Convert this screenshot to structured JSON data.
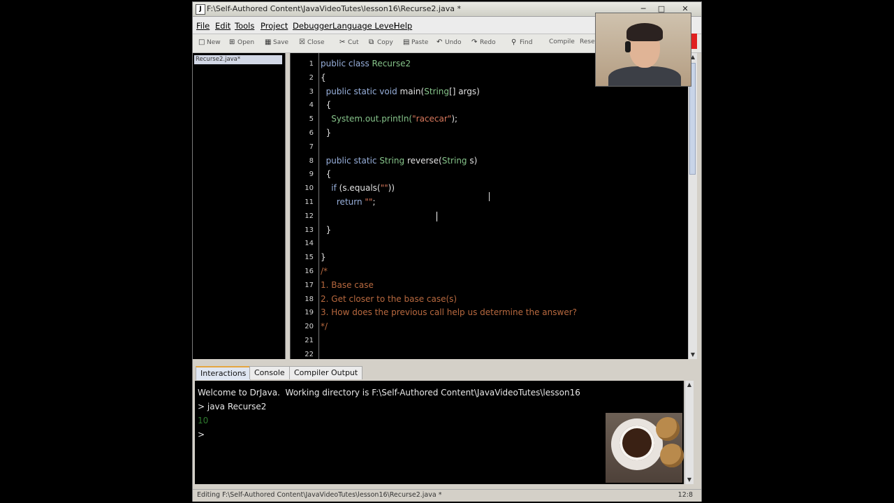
{
  "window": {
    "title": "F:\\Self-Authored Content\\JavaVideoTutes\\lesson16\\Recurse2.java *",
    "icon_letter": "J",
    "controls": [
      "minimize-icon",
      "maximize-icon",
      "close-icon"
    ]
  },
  "menu": {
    "items": [
      "File",
      "Edit",
      "Tools",
      "Project",
      "Debugger",
      "Language Level",
      "Help"
    ]
  },
  "toolbar": {
    "buttons": [
      {
        "label": "New",
        "icon": "new-icon"
      },
      {
        "label": "Open",
        "icon": "open-icon"
      },
      {
        "label": "Save",
        "icon": "save-icon"
      },
      {
        "label": "Close",
        "icon": "close-file-icon"
      },
      {
        "label": "Cut",
        "icon": "cut-icon"
      },
      {
        "label": "Copy",
        "icon": "copy-icon"
      },
      {
        "label": "Paste",
        "icon": "paste-icon"
      },
      {
        "label": "Undo",
        "icon": "undo-icon"
      },
      {
        "label": "Redo",
        "icon": "redo-icon"
      },
      {
        "label": "Find",
        "icon": "find-icon"
      },
      {
        "label": "Compile",
        "icon": ""
      },
      {
        "label": "Reset",
        "icon": ""
      }
    ]
  },
  "documents": {
    "items": [
      "Recurse2.java*"
    ]
  },
  "editor": {
    "line_numbers": [
      "1",
      "2",
      "3",
      "4",
      "5",
      "6",
      "7",
      "8",
      "9",
      "10",
      "11",
      "12",
      "13",
      "14",
      "15",
      "16",
      "17",
      "18",
      "19",
      "20",
      "21",
      "22"
    ],
    "lines": [
      {
        "segments": [
          {
            "t": "public class ",
            "c": "kw"
          },
          {
            "t": "Recurse2",
            "c": "ty"
          }
        ]
      },
      {
        "segments": [
          {
            "t": "{",
            "c": ""
          }
        ]
      },
      {
        "segments": [
          {
            "t": "  public static void ",
            "c": "kw"
          },
          {
            "t": "main(",
            "c": ""
          },
          {
            "t": "String",
            "c": "ty"
          },
          {
            "t": "[] args)",
            "c": ""
          }
        ]
      },
      {
        "segments": [
          {
            "t": "  {",
            "c": ""
          }
        ]
      },
      {
        "segments": [
          {
            "t": "    ",
            "c": ""
          },
          {
            "t": "System.out.println(",
            "c": "ty"
          },
          {
            "t": "\"racecar\"",
            "c": "str"
          },
          {
            "t": ");",
            "c": ""
          }
        ]
      },
      {
        "segments": [
          {
            "t": "  }",
            "c": ""
          }
        ]
      },
      {
        "segments": [
          {
            "t": "",
            "c": ""
          }
        ]
      },
      {
        "segments": [
          {
            "t": "  public static ",
            "c": "kw"
          },
          {
            "t": "String",
            "c": "ty"
          },
          {
            "t": " reverse(",
            "c": ""
          },
          {
            "t": "String",
            "c": "ty"
          },
          {
            "t": " s)",
            "c": ""
          }
        ]
      },
      {
        "segments": [
          {
            "t": "  {",
            "c": ""
          }
        ]
      },
      {
        "segments": [
          {
            "t": "    ",
            "c": ""
          },
          {
            "t": "if",
            "c": "kw"
          },
          {
            "t": " (s.equals(",
            "c": ""
          },
          {
            "t": "\"\"",
            "c": "str"
          },
          {
            "t": "))",
            "c": ""
          }
        ]
      },
      {
        "segments": [
          {
            "t": "      ",
            "c": ""
          },
          {
            "t": "return",
            "c": "kw"
          },
          {
            "t": " ",
            "c": ""
          },
          {
            "t": "\"\"",
            "c": "str"
          },
          {
            "t": ";",
            "c": ""
          }
        ]
      },
      {
        "segments": [
          {
            "t": "",
            "c": ""
          }
        ]
      },
      {
        "segments": [
          {
            "t": "  }",
            "c": ""
          }
        ]
      },
      {
        "segments": [
          {
            "t": "",
            "c": ""
          }
        ]
      },
      {
        "segments": [
          {
            "t": "}",
            "c": ""
          }
        ]
      },
      {
        "segments": [
          {
            "t": "/*",
            "c": "cm"
          }
        ]
      },
      {
        "segments": [
          {
            "t": "1. Base case",
            "c": "cm"
          }
        ]
      },
      {
        "segments": [
          {
            "t": "2. Get closer to the base case(s)",
            "c": "cm"
          }
        ]
      },
      {
        "segments": [
          {
            "t": "3. How does the previous call help us determine the answer?",
            "c": "cm"
          }
        ]
      },
      {
        "segments": [
          {
            "t": "*/",
            "c": "cm"
          }
        ]
      },
      {
        "segments": [
          {
            "t": "",
            "c": ""
          }
        ]
      },
      {
        "segments": [
          {
            "t": "",
            "c": ""
          }
        ]
      }
    ]
  },
  "bottom_tabs": {
    "items": [
      "Interactions",
      "Console",
      "Compiler Output"
    ],
    "active": "Interactions",
    "accent": "#e4a640"
  },
  "interactions": {
    "lines": [
      {
        "text": "Welcome to DrJava.  Working directory is F:\\Self-Authored Content\\JavaVideoTutes\\lesson16",
        "color": "#e8e8e8"
      },
      {
        "text": "> java Recurse2",
        "color": "#e8e8e8"
      },
      {
        "text": "10",
        "color": "#2f7a2f"
      },
      {
        "text": ">",
        "color": "#e8e8e8"
      }
    ]
  },
  "status": {
    "text": "Editing F:\\Self-Authored Content\\JavaVideoTutes\\lesson16\\Recurse2.java *",
    "position": "12:8"
  },
  "colors": {
    "keyword": "#98b0dc",
    "type": "#86c48a",
    "string": "#d9785c",
    "comment": "#b8693f",
    "editor_bg": "#000000"
  }
}
